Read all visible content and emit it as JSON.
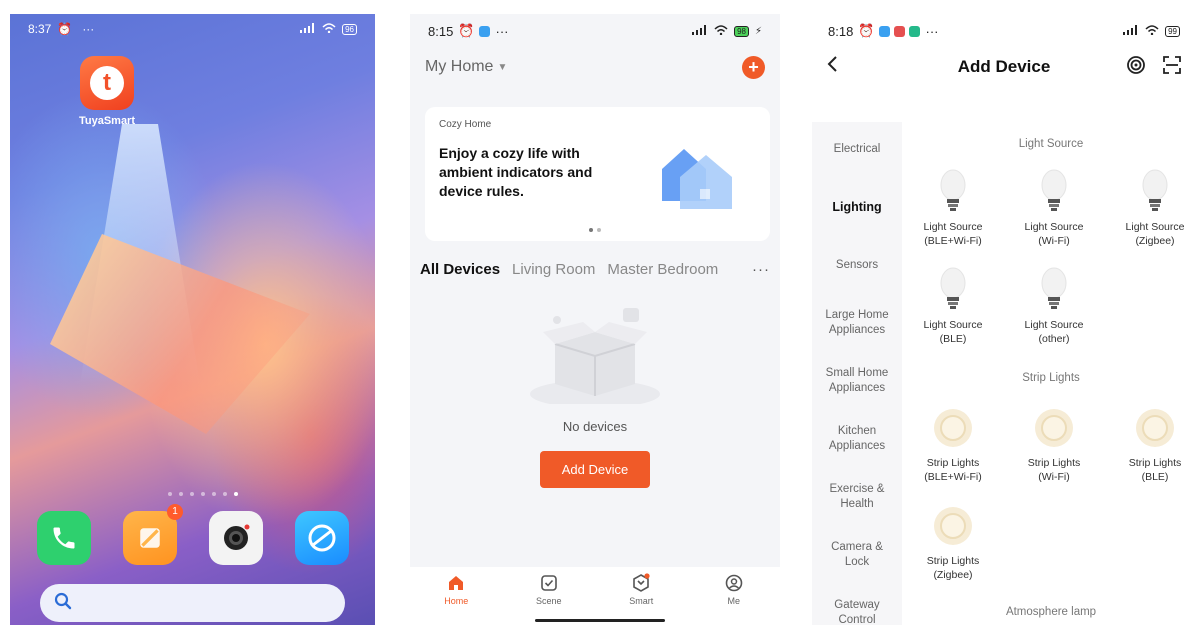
{
  "launcher": {
    "status": {
      "time": "8:37",
      "more": "···",
      "battery": "96"
    },
    "app": {
      "label": "TuyaSmart",
      "glyph": "t"
    },
    "dock": {
      "notes_badge": "1"
    }
  },
  "home": {
    "status": {
      "time": "8:15",
      "more": "···",
      "battery": "98"
    },
    "title": "My Home",
    "add_glyph": "+",
    "banner": {
      "tag": "Cozy Home",
      "text": "Enjoy a cozy life with ambient indicators and device rules."
    },
    "tabs": [
      "All Devices",
      "Living Room",
      "Master Bedroom"
    ],
    "more": "···",
    "empty_text": "No devices",
    "add_device_label": "Add Device",
    "tabbar": [
      {
        "label": "Home",
        "icon": "home-icon"
      },
      {
        "label": "Scene",
        "icon": "scene-icon"
      },
      {
        "label": "Smart",
        "icon": "smart-icon"
      },
      {
        "label": "Me",
        "icon": "me-icon"
      }
    ]
  },
  "add_device": {
    "status": {
      "time": "8:18",
      "more": "···",
      "battery": "99"
    },
    "title": "Add Device",
    "categories": [
      "Electrical",
      "Lighting",
      "Sensors",
      "Large Home Appliances",
      "Small Home Appliances",
      "Kitchen Appliances",
      "Exercise & Health",
      "Camera & Lock",
      "Gateway Control"
    ],
    "active_category": "Lighting",
    "sections": [
      "Light Source",
      "Strip Lights",
      "Atmosphere lamp"
    ],
    "light_devices": [
      {
        "name": "Light Source",
        "sub": "(BLE+Wi-Fi)"
      },
      {
        "name": "Light Source",
        "sub": "(Wi-Fi)"
      },
      {
        "name": "Light Source",
        "sub": "(Zigbee)"
      },
      {
        "name": "Light Source",
        "sub": "(BLE)"
      },
      {
        "name": "Light Source",
        "sub": "(other)"
      }
    ],
    "strip_devices": [
      {
        "name": "Strip Lights",
        "sub": "(BLE+Wi-Fi)"
      },
      {
        "name": "Strip Lights",
        "sub": "(Wi-Fi)"
      },
      {
        "name": "Strip Lights",
        "sub": "(BLE)"
      },
      {
        "name": "Strip Lights",
        "sub": "(Zigbee)"
      }
    ]
  },
  "colors": {
    "accent": "#f05a28",
    "tuya_brand": "#f2522b"
  }
}
